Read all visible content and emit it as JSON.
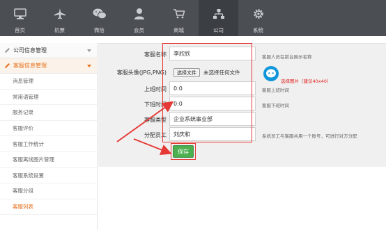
{
  "topnav": {
    "items": [
      {
        "label": "首页",
        "icon": "monitor-icon"
      },
      {
        "label": "机票",
        "icon": "airplane-icon"
      },
      {
        "label": "微信",
        "icon": "wechat-icon"
      },
      {
        "label": "会员",
        "icon": "person-icon"
      },
      {
        "label": "商城",
        "icon": "cart-icon"
      },
      {
        "label": "公司",
        "icon": "org-chart-icon"
      },
      {
        "label": "系统",
        "icon": "gear-icon"
      }
    ],
    "active": "公司"
  },
  "sidebar": {
    "group1": {
      "label": "公司信息管理"
    },
    "group2": {
      "label": "客服信息管理"
    },
    "items": [
      {
        "label": "消息管理"
      },
      {
        "label": "常用语管理"
      },
      {
        "label": "服务记录"
      },
      {
        "label": "客服评价"
      },
      {
        "label": "客服工作统计"
      },
      {
        "label": "客服离线图片管理"
      },
      {
        "label": "客服系统设置"
      },
      {
        "label": "客服分组"
      },
      {
        "label": "客服列表"
      }
    ]
  },
  "form": {
    "name": {
      "label": "客服名称",
      "value": "李欣欣",
      "hint": "客服人员在前台展示名称"
    },
    "avatar": {
      "label": "客服头像(JPG,PNG)",
      "button": "选择文件",
      "file_status": "未选择任何文件",
      "note": "选择图片（建议40x40）"
    },
    "start": {
      "label": "上班时间",
      "value": "0:0",
      "hint": "客服上班时间"
    },
    "end": {
      "label": "下班时间",
      "value": "0:0",
      "hint": "客服下班时间"
    },
    "type": {
      "label": "客服类型",
      "value": "企业系统事业部"
    },
    "staff": {
      "label": "分配员工",
      "value": "刘庆和",
      "hint": "系统员工与客服共用一个账号，可进行对方分配"
    },
    "save": "保存"
  },
  "colors": {
    "nav_bg": "#4b4e53",
    "accent": "#e8711c",
    "save_green": "#4caf50",
    "annotation_red": "#e53935"
  }
}
